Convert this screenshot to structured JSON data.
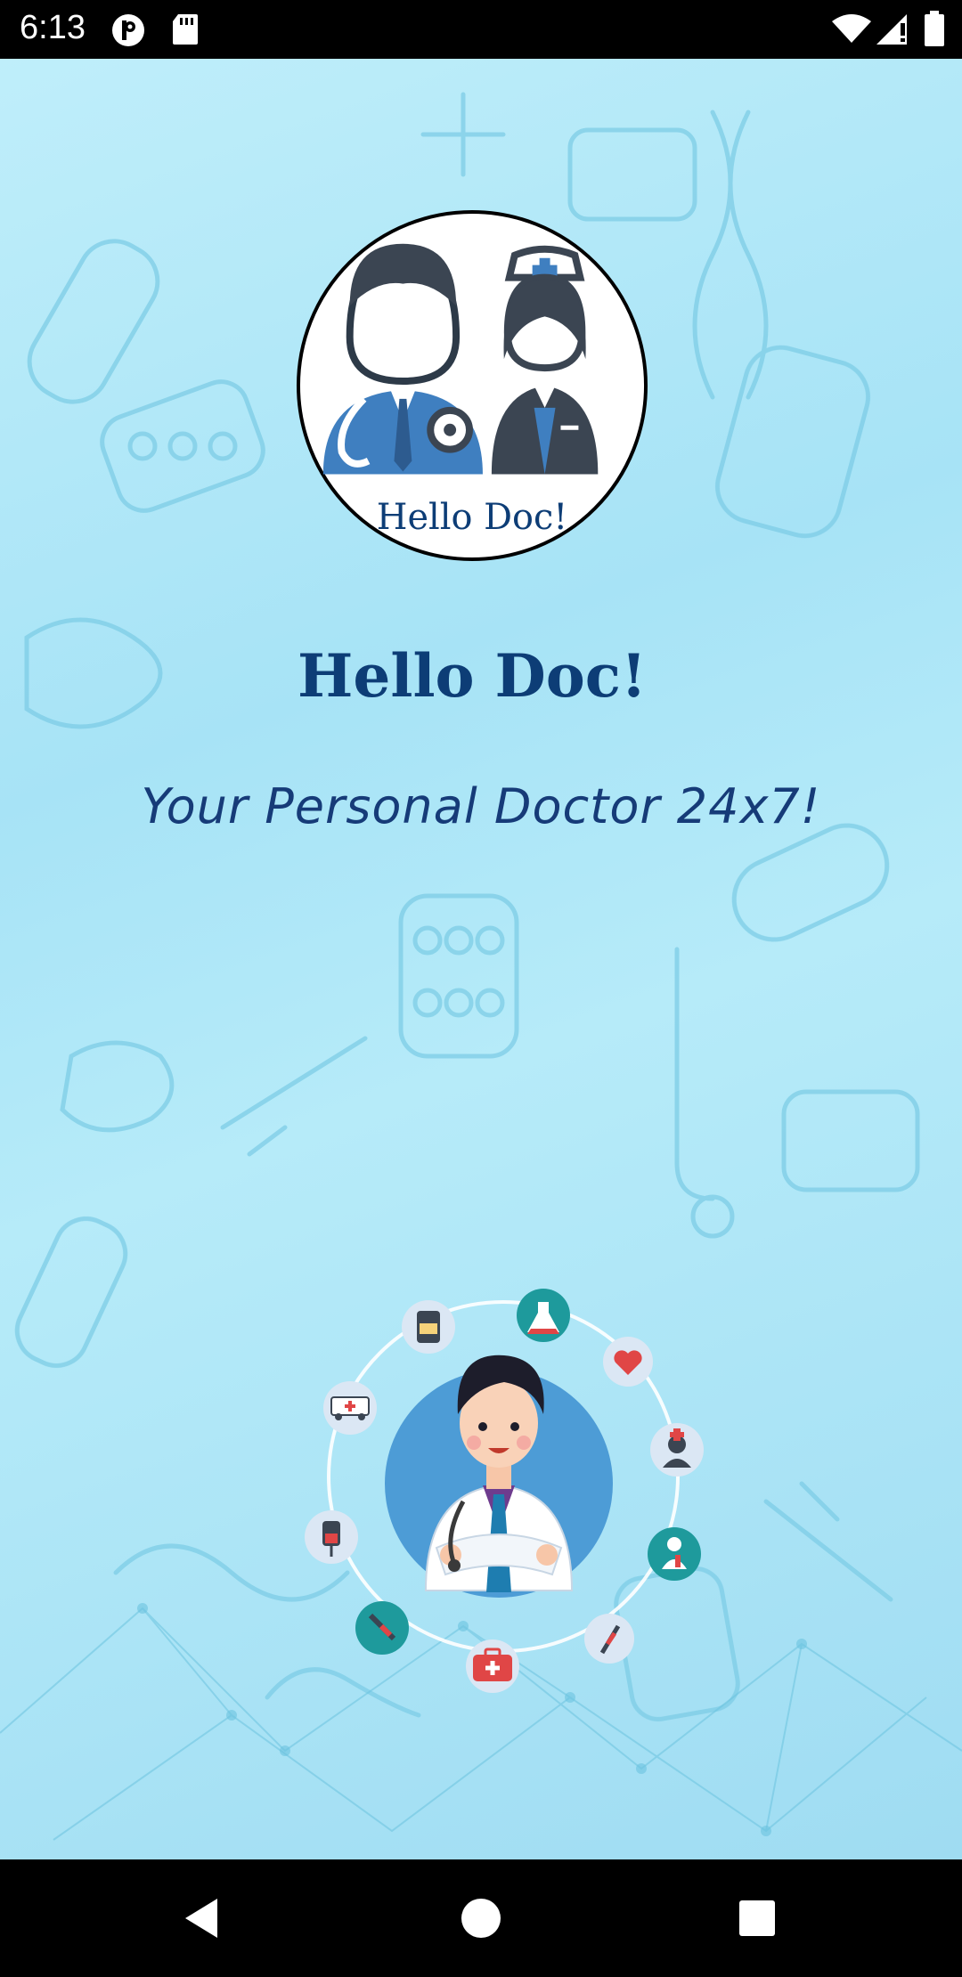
{
  "status_bar": {
    "time": "6:13",
    "left_icons": [
      "p-badge-icon",
      "sd-card-icon"
    ],
    "right_icons": [
      "wifi-icon",
      "cell-signal-icon",
      "battery-icon"
    ]
  },
  "splash": {
    "logo_text": "Hello Doc!",
    "title": "Hello Doc!",
    "tagline": "Your Personal Doctor 24x7!",
    "hero_icons": [
      "medicine-bottle-icon",
      "flask-icon",
      "heart-icon",
      "ambulance-icon",
      "nurse-icon",
      "iv-bag-icon",
      "patient-icon",
      "syringe-icon",
      "injection-icon",
      "first-aid-kit-icon"
    ]
  },
  "nav_bar": {
    "buttons": [
      "back-icon",
      "home-icon",
      "recents-icon"
    ]
  },
  "colors": {
    "title": "#0d3d76",
    "accent_teal": "#1e9a9c",
    "doctor_blue": "#3f7fc0",
    "background_light": "#bfeefa"
  }
}
